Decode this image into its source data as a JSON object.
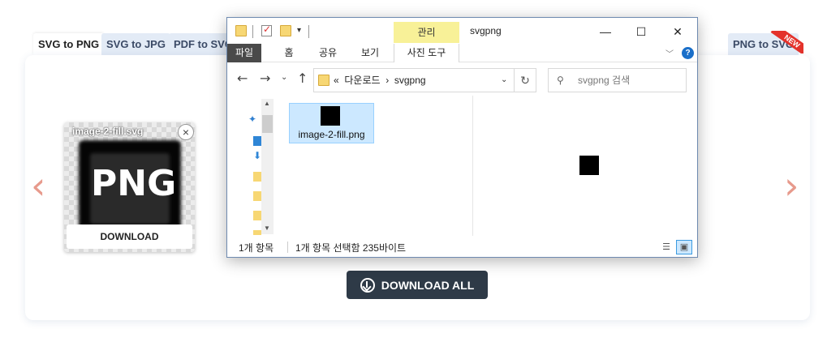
{
  "tabs": [
    "SVG to PNG",
    "SVG to JPG",
    "PDF to SVG",
    "PNG to SVG"
  ],
  "new_badge": "NEW",
  "nav": {
    "prev_icon": "chevron-left-icon",
    "next_icon": "chevron-right-icon"
  },
  "thumbnail": {
    "file_name": "image-2-fill.svg",
    "format_label": "PNG",
    "download_label": "DOWNLOAD",
    "close_icon": "close-icon"
  },
  "download_all_label": "DOWNLOAD ALL",
  "explorer": {
    "title": "svgpng",
    "manage_tab": "관리",
    "ribbon_tabs": [
      "파일",
      "홈",
      "공유",
      "보기"
    ],
    "photo_tools_tab": "사진 도구",
    "window_buttons": {
      "minimize": "—",
      "maximize": "☐",
      "close": "✕"
    },
    "address": {
      "prefix": "«",
      "crumbs": [
        "다운로드",
        "svgpng"
      ]
    },
    "search_placeholder": "svgpng 검색",
    "file": {
      "name": "image-2-fill.png"
    },
    "status": {
      "count": "1개 항목",
      "selected": "1개 항목 선택함 235바이트"
    },
    "colors": {
      "selection": "#cce8ff",
      "manage_highlight": "#f8f198",
      "file_tab": "#4a4a4a"
    }
  },
  "colors": {
    "accent_arrow": "#e79a8c",
    "button_dark": "#2e3a47",
    "tab_bg": "#e3ebf6",
    "new_badge": "#e4322b"
  }
}
